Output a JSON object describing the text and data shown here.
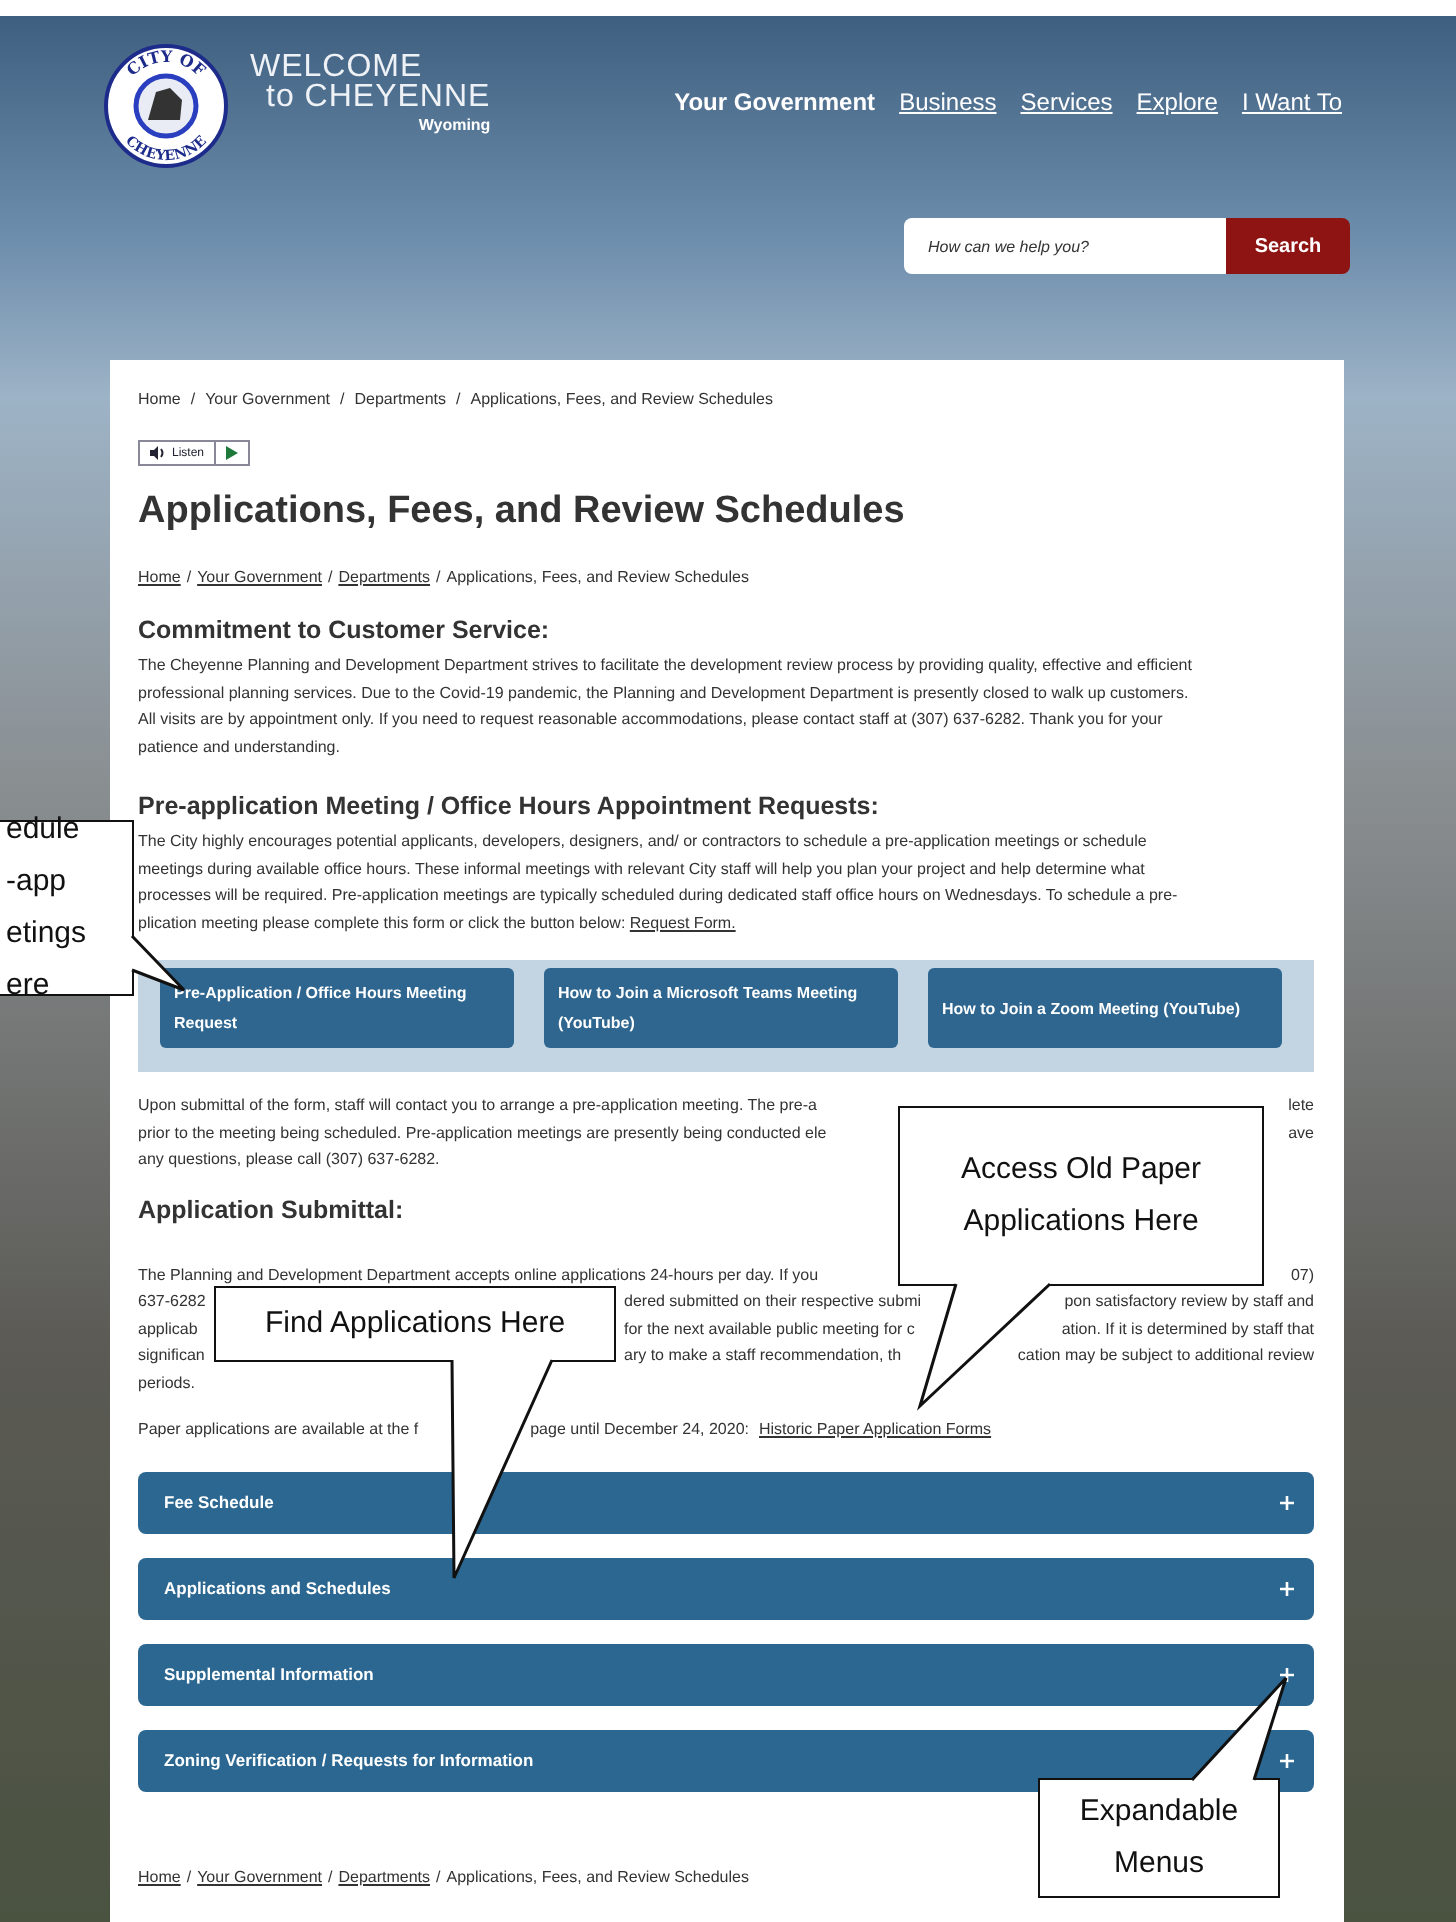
{
  "header": {
    "seal_top": "CITY OF",
    "seal_bottom": "CHEYENNE",
    "site_title": [
      "WELCOME",
      "to CHEYENNE"
    ],
    "site_subtitle": "Wyoming",
    "nav": [
      {
        "label": "Your Government",
        "selected": true
      },
      {
        "label": "Business",
        "selected": false
      },
      {
        "label": "Services",
        "selected": false
      },
      {
        "label": "Explore",
        "selected": false
      },
      {
        "label": "I Want To",
        "selected": false
      }
    ],
    "search": {
      "placeholder": "How can we help you?",
      "button": "Search"
    }
  },
  "breadcrumb": {
    "separator": "/",
    "items": [
      "Home",
      "Your Government",
      "Departments",
      "Applications, Fees, and Review Schedules"
    ]
  },
  "listen": {
    "label": "Listen"
  },
  "title": "Applications, Fees, and Review Schedules",
  "breadcrumb_links": {
    "separator": "/",
    "items": [
      {
        "label": "Home",
        "kind": "link"
      },
      {
        "label": "Your Government",
        "kind": "link"
      },
      {
        "label": "Departments",
        "kind": "link"
      },
      {
        "label": "Applications, Fees, and Review Schedules",
        "kind": "text"
      }
    ]
  },
  "commitment": {
    "heading": "Commitment to Customer Service:",
    "lines": [
      [
        {
          "text": "The Cheyenne Planning and Development Department strives to facilitate the development review process by providing quality, effective and efficient",
          "kind": "text"
        }
      ],
      [
        {
          "text": "professional planning services.  Due to the Covid-19 pandemic, the Planning and Development Department is presently closed to walk up customers.",
          "kind": "text"
        }
      ],
      [
        {
          "text": "All visits are by appointment only. If you need to request reasonable accommodations, please contact staff at (307) 637-6282. Thank you for your",
          "kind": "text"
        }
      ],
      [
        {
          "text": "patience and understanding.",
          "kind": "text"
        }
      ]
    ]
  },
  "pre_application": {
    "heading": "Pre-application Meeting / Office Hours Appointment Requests:",
    "lines": [
      [
        {
          "text": "The City highly encourages potential applicants, developers, designers, and/ or contractors to schedule a pre-application meetings or schedule",
          "kind": "text"
        }
      ],
      [
        {
          "text": "meetings during available office hours. These informal meetings with relevant City staff will help you plan your project and help determine what",
          "kind": "text"
        }
      ],
      [
        {
          "text": "processes will be required. Pre-application meetings are typically scheduled during dedicated staff office hours on Wednesdays.  To schedule a pre-",
          "kind": "text"
        }
      ],
      [
        {
          "text": "plication meeting please complete this form or click the button below: ",
          "kind": "text"
        },
        {
          "text": "Request Form.",
          "kind": "link"
        }
      ]
    ],
    "buttons": [
      "Pre-Application / Office Hours Meeting Request",
      "How to Join a Microsoft Teams Meeting (YouTube)",
      "How to Join a Zoom Meeting (YouTube)"
    ]
  },
  "follow_up": {
    "lines": [
      [
        "Upon submittal of the form, staff will contact you to arrange a pre-application meeting.  The pre-a",
        "lete"
      ],
      [
        "prior to the meeting being scheduled. Pre-application meetings are presently being conducted ele",
        "ave"
      ],
      [
        "any questions, please call (307) 637-6282."
      ]
    ]
  },
  "submittal": {
    "heading": "Application Submittal:",
    "lines": [
      [
        "The Planning and Development Department accepts online applications 24-hours per day.  If you",
        "07)"
      ],
      [
        "637-6282",
        "dered submitted on their respective submi",
        "pon satisfactory review by staff and"
      ],
      [
        "applicab",
        "for the next available public meeting for c",
        "ation. If it is determined by staff that"
      ],
      [
        "significan",
        "ary to make a staff recommendation, th",
        "cation may be subject to additional review"
      ],
      [
        "periods."
      ]
    ],
    "paper_line": {
      "before": "Paper applications are available at the f",
      "after": "page until December 24, 2020:",
      "link": "Historic Paper Application Forms"
    }
  },
  "accordions": [
    {
      "label": "Fee Schedule",
      "expanded": false
    },
    {
      "label": "Applications and Schedules",
      "expanded": false
    },
    {
      "label": "Supplemental Information",
      "expanded": false
    },
    {
      "label": "Zoning Verification / Requests for Information",
      "expanded": false
    }
  ],
  "footer_breadcrumb": {
    "separator": "/",
    "items": [
      {
        "label": "Home",
        "kind": "link"
      },
      {
        "label": "Your Government",
        "kind": "link"
      },
      {
        "label": "Departments",
        "kind": "link"
      },
      {
        "label": "Applications, Fees, and Review Schedules",
        "kind": "text"
      }
    ]
  },
  "callouts": [
    {
      "lines": [
        "edule",
        "-app",
        "etings",
        "ere"
      ]
    },
    {
      "lines": [
        "Access Old Paper",
        "Applications Here"
      ]
    },
    {
      "lines": [
        "Find Applications Here"
      ]
    },
    {
      "lines": [
        "Expandable",
        "Menus"
      ]
    }
  ]
}
